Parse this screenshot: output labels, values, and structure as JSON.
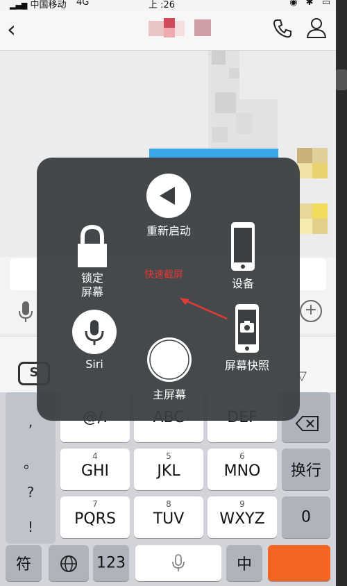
{
  "status_bar": {
    "carrier": "中国移动",
    "network": "4G",
    "time": "上 :26"
  },
  "nav_bar": {
    "back_icon": "chevron-left-icon",
    "phone_icon": "phone-icon",
    "profile_icon": "person-icon"
  },
  "assistive_touch": {
    "restart_label": "重新启动",
    "lock_label": "锁定\n屏幕",
    "device_label": "设备",
    "siri_label": "Siri",
    "screenshot_label": "屏幕快照",
    "home_label": "主屏幕"
  },
  "annotation": {
    "text": "快速截屏",
    "color": "#e53935"
  },
  "keyboard": {
    "side_punct": [
      ",",
      "。",
      "?",
      "!"
    ],
    "rows": [
      {
        "keys": [
          {
            "num": "",
            "label": "@/."
          },
          {
            "num": "",
            "label": "ABC"
          },
          {
            "num": "",
            "label": "DEF"
          }
        ]
      },
      {
        "keys": [
          {
            "num": "4",
            "label": "GHI"
          },
          {
            "num": "5",
            "label": "JKL"
          },
          {
            "num": "6",
            "label": "MNO"
          }
        ]
      },
      {
        "keys": [
          {
            "num": "7",
            "label": "PQRS"
          },
          {
            "num": "8",
            "label": "TUV"
          },
          {
            "num": "9",
            "label": "WXYZ"
          }
        ]
      }
    ],
    "delete_icon": "backspace-icon",
    "newline_label": "换行",
    "zero_label": "0",
    "symbol_label": "符",
    "globe_icon": "globe-icon",
    "num_label": "123",
    "mic_icon": "mic-icon",
    "zh_label": "中"
  },
  "accent_colors": {
    "chat_bubble": "#3aa8e6",
    "orange_key": "#f26522"
  }
}
